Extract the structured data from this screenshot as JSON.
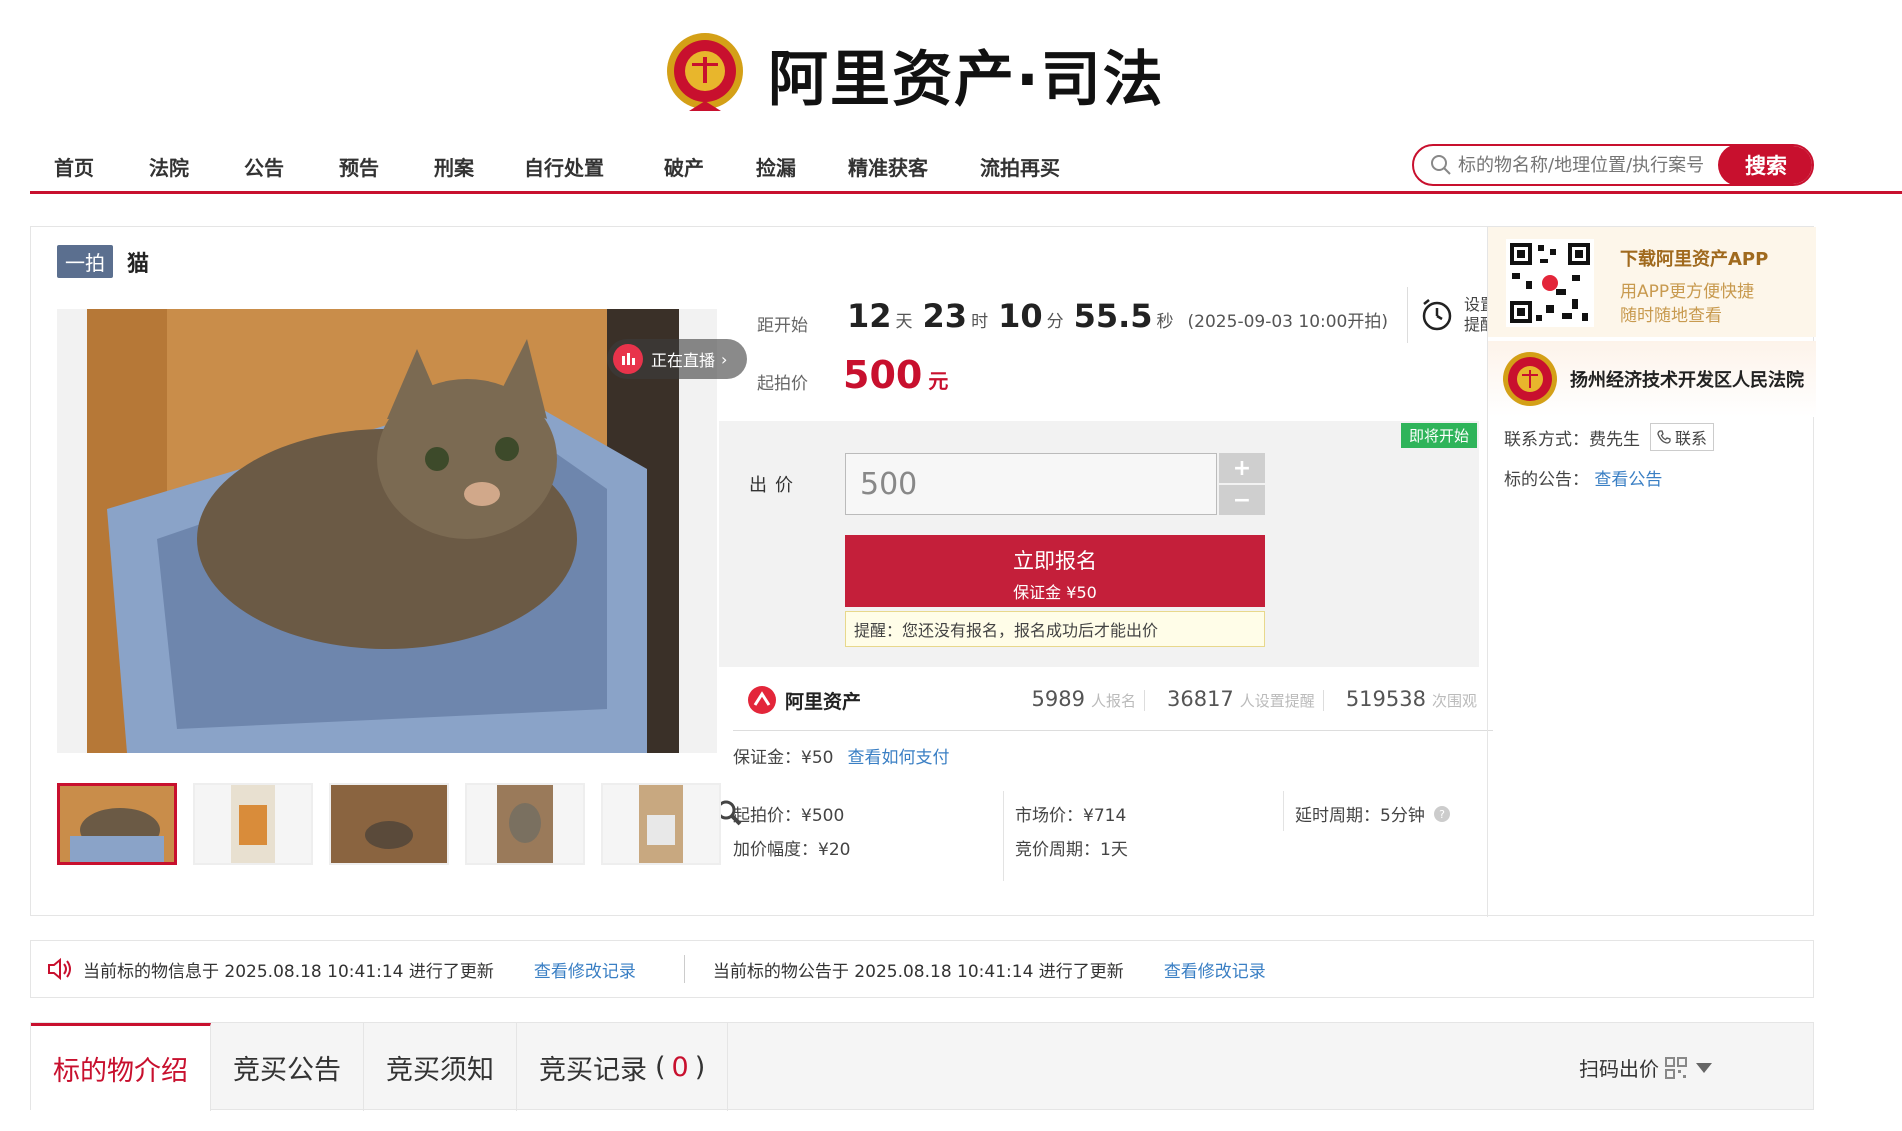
{
  "site": {
    "logo_text": "阿里资产·司法"
  },
  "nav": {
    "items": [
      "首页",
      "法院",
      "公告",
      "预告",
      "刑案",
      "自行处置",
      "破产",
      "捡漏",
      "精准获客",
      "流拍再买"
    ],
    "search_placeholder": "标的物名称/地理位置/执行案号",
    "search_button": "搜索"
  },
  "item": {
    "round_badge": "一拍",
    "title": "猫",
    "live_label": "正在直播",
    "live_arrow": "›"
  },
  "countdown": {
    "label": "距开始",
    "days": "12",
    "days_unit": "天",
    "hours": "23",
    "hours_unit": "时",
    "minutes": "10",
    "minutes_unit": "分",
    "seconds": "55.5",
    "seconds_unit": "秒",
    "start_note": "(2025-09-03 10:00开拍)",
    "reminder_line1": "设置",
    "reminder_line2": "提醒"
  },
  "start_price": {
    "label": "起拍价",
    "value": "500",
    "unit": "元"
  },
  "bid": {
    "status_tag": "即将开始",
    "label": "出价",
    "input_value": "500",
    "plus": "+",
    "minus": "−",
    "register_label": "立即报名",
    "register_deposit": "保证金 ¥50",
    "notice": "提醒：您还没有报名，报名成功后才能出价"
  },
  "stats": {
    "brand": "阿里资产",
    "registrations": "5989",
    "registrations_unit": "人报名",
    "reminders": "36817",
    "reminders_unit": "人设置提醒",
    "views": "519538",
    "views_unit": "次围观"
  },
  "params": {
    "deposit": "保证金：¥50",
    "how_to_pay": "查看如何支付",
    "start_price": "起拍价：¥500",
    "increment": "加价幅度：¥20",
    "market_price": "市场价：¥714",
    "auction_period": "竞价周期：1天",
    "delay_period": "延时周期：5分钟"
  },
  "app_promo": {
    "title": "下载阿里资产APP",
    "desc1": "用APP更方便快捷",
    "desc2": "随时随地查看"
  },
  "court": {
    "name": "扬州经济技术开发区人民法院",
    "contact_label": "联系方式：费先生",
    "contact_button": "联系",
    "notice_label": "标的公告：",
    "notice_link": "查看公告"
  },
  "update_bar": {
    "info_update": "当前标的物信息于 2025.08.18 10:41:14 进行了更新",
    "info_link": "查看修改记录",
    "notice_update": "当前标的物公告于 2025.08.18 10:41:14 进行了更新",
    "notice_link": "查看修改记录"
  },
  "tabs": {
    "intro": "标的物介绍",
    "announcement": "竞买公告",
    "rules": "竞买须知",
    "records": "竞买记录",
    "records_open": "(",
    "records_count": "0",
    "records_close": ")",
    "scan_bid": "扫码出价"
  },
  "colors": {
    "brand_red": "#c8102e",
    "link_blue": "#3a7fc4",
    "status_green": "#2fb45a"
  }
}
